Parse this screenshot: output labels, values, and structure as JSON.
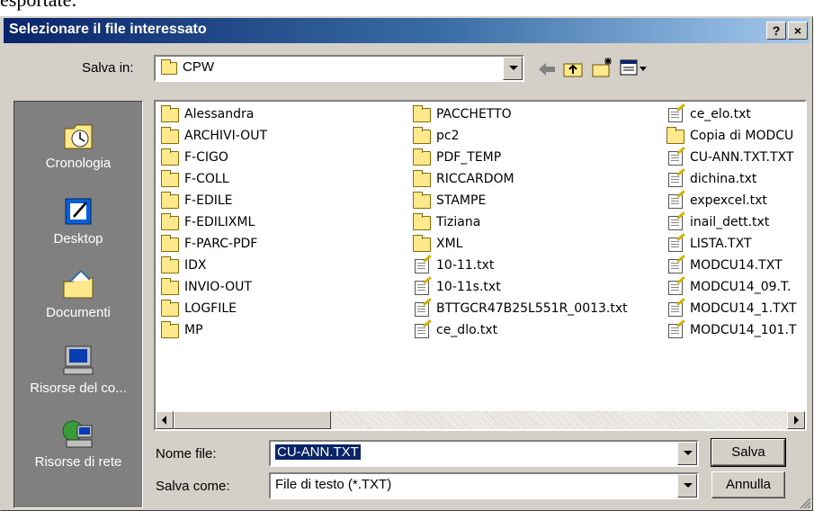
{
  "background_text": "esportate:",
  "window": {
    "title": "Selezionare il file interessato",
    "help_label": "?",
    "close_label": "×"
  },
  "location": {
    "label": "Salva in:",
    "value": "CPW"
  },
  "places": [
    {
      "label": "Cronologia",
      "icon": "history-icon"
    },
    {
      "label": "Desktop",
      "icon": "desktop-icon"
    },
    {
      "label": "Documenti",
      "icon": "documents-icon"
    },
    {
      "label": "Risorse del co...",
      "icon": "computer-icon"
    },
    {
      "label": "Risorse di rete",
      "icon": "network-icon"
    }
  ],
  "files": {
    "col1": [
      "Alessandra",
      "ARCHIVI-OUT",
      "F-CIGO",
      "F-COLL",
      "F-EDILE",
      "F-EDILIXML",
      "F-PARC-PDF",
      "IDX",
      "INVIO-OUT",
      "LOGFILE",
      "MP"
    ],
    "col2": [
      "PACCHETTO",
      "pc2",
      "PDF_TEMP",
      "RICCARDOM",
      "STAMPE",
      "Tiziana",
      "XML",
      "10-11.txt",
      "10-11s.txt",
      "BTTGCR47B25L551R_0013.txt",
      "ce_dlo.txt"
    ],
    "col3": [
      "ce_elo.txt",
      "Copia di MODCU",
      "CU-ANN.TXT.TXT",
      "dichina.txt",
      "expexcel.txt",
      "inail_dett.txt",
      "LISTA.TXT",
      "MODCU14.TXT",
      "MODCU14_09.T.",
      "MODCU14_1.TXT",
      "MODCU14_101.T"
    ]
  },
  "filename": {
    "label": "Nome file:",
    "value": "CU-ANN.TXT"
  },
  "filetype": {
    "label": "Salva come:",
    "value": "File di testo (*.TXT)"
  },
  "buttons": {
    "save": "Salva",
    "cancel": "Annulla"
  }
}
